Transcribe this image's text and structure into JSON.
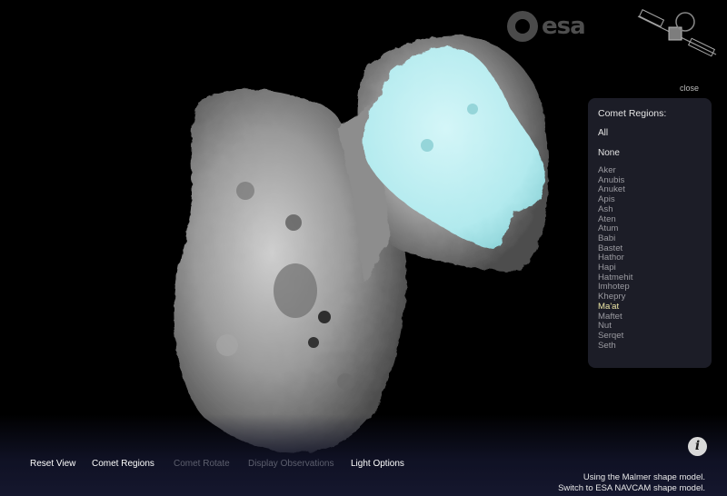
{
  "branding": {
    "logo_text": "esa",
    "logo_icon": "esa-logo-icon",
    "satellite_icon": "rosetta-satellite-icon"
  },
  "viewer": {
    "highlighted_region_color": "#b7eef2",
    "comet_color": "#9a9a9a"
  },
  "region_panel": {
    "close_label": "close",
    "title": "Comet Regions:",
    "all_label": "All",
    "none_label": "None",
    "regions": [
      "Aker",
      "Anubis",
      "Anuket",
      "Apis",
      "Ash",
      "Aten",
      "Atum",
      "Babi",
      "Bastet",
      "Hathor",
      "Hapi",
      "Hatmehit",
      "Imhotep",
      "Khepry",
      "Ma'at",
      "Maftet",
      "Nut",
      "Serqet",
      "Seth"
    ],
    "selected_region": "Ma'at",
    "selected_color": "#ece6a6"
  },
  "toolbar": {
    "items": [
      {
        "label": "Reset View",
        "enabled": true
      },
      {
        "label": "Comet Regions",
        "enabled": true
      },
      {
        "label": "Comet Rotate",
        "enabled": false
      },
      {
        "label": "Display Observations",
        "enabled": false
      },
      {
        "label": "Light Options",
        "enabled": true
      }
    ],
    "info_label": "i"
  },
  "model_info": {
    "current": "Using the Malmer shape model.",
    "switch_link": "Switch to ESA NAVCAM shape model."
  }
}
